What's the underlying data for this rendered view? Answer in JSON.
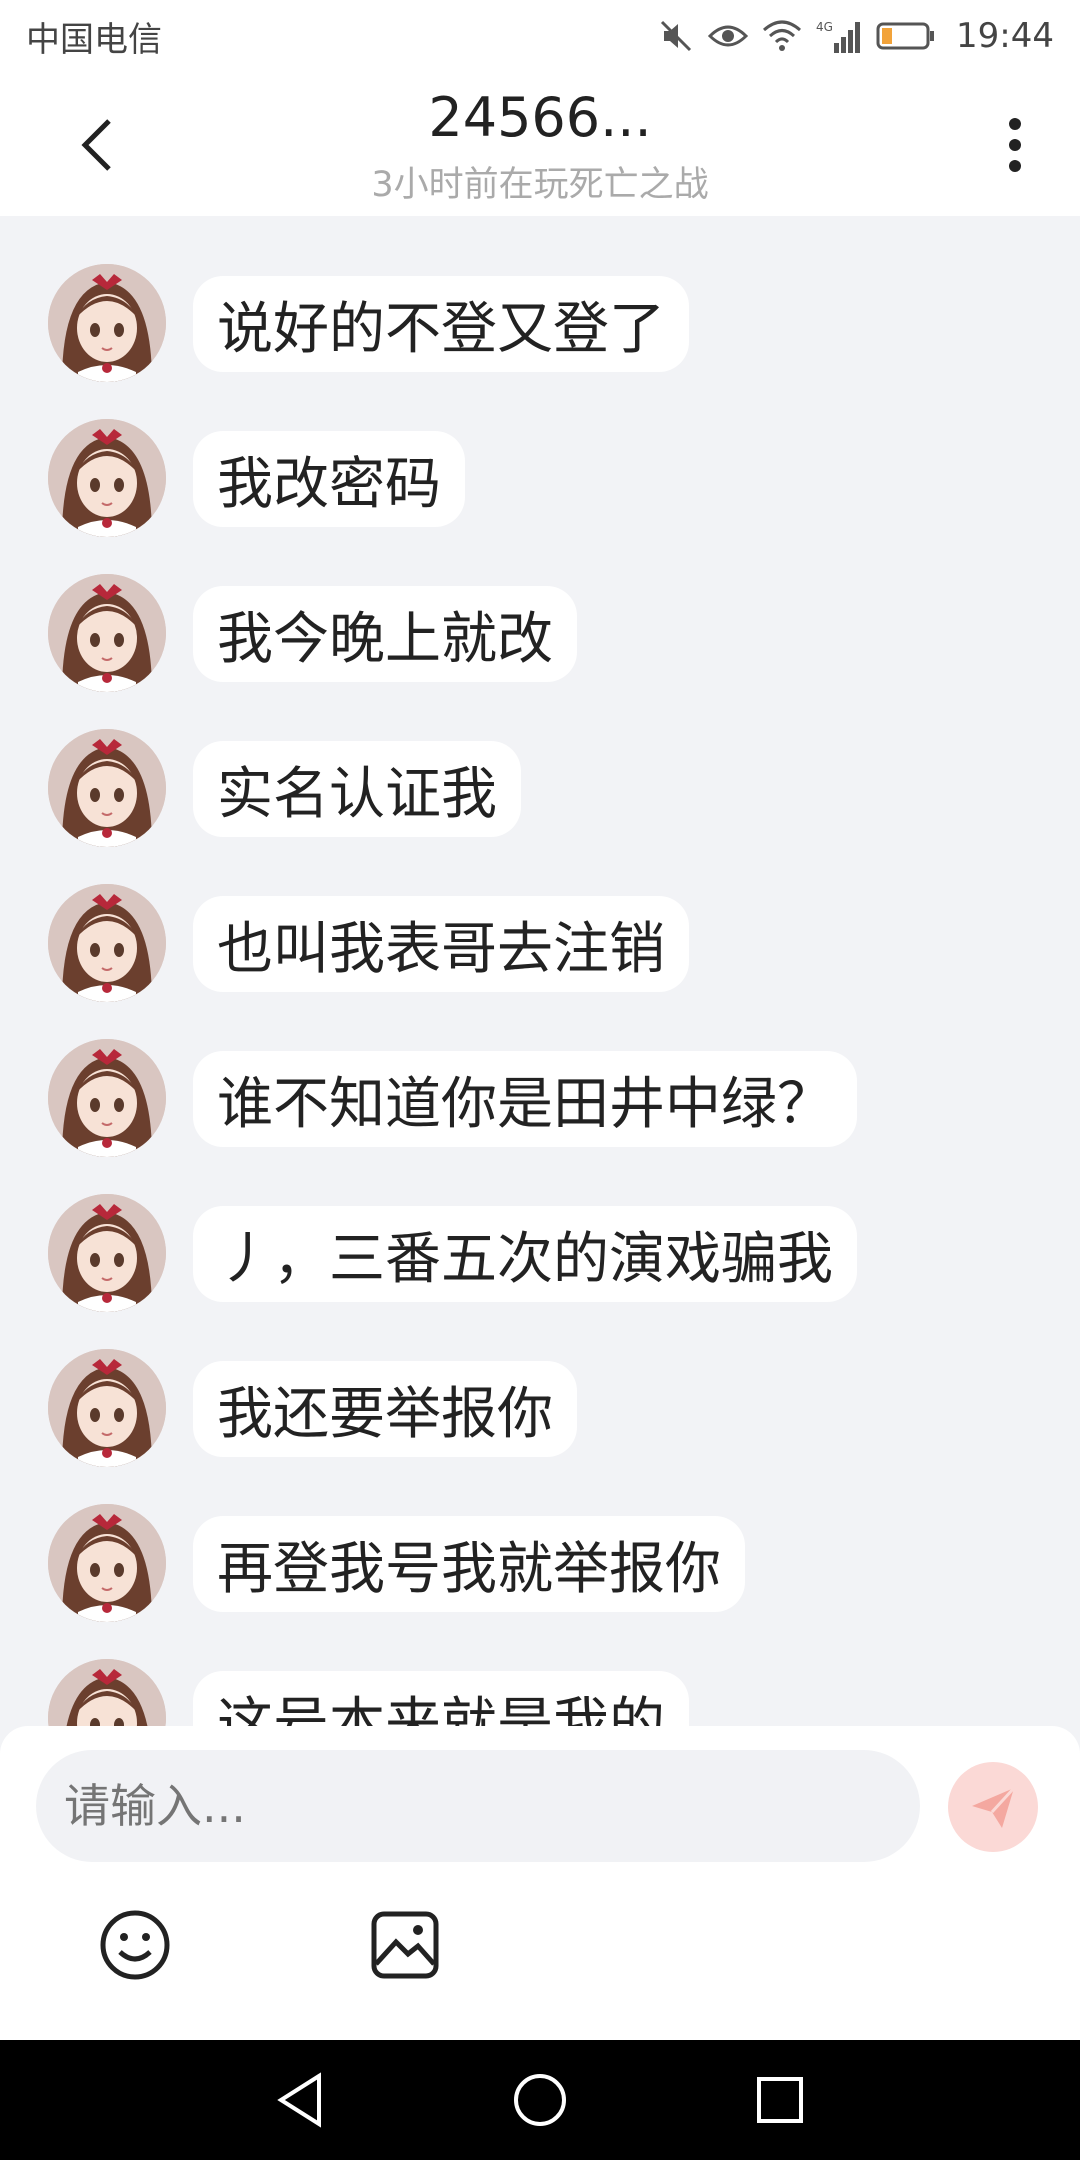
{
  "status_bar": {
    "carrier": "中国电信",
    "network": "4G",
    "time": "19:44",
    "icons": [
      "mute-icon",
      "eye-icon",
      "wifi-icon",
      "signal-icon",
      "battery-icon"
    ]
  },
  "header": {
    "title": "24566...",
    "subtitle": "3小时前在玩死亡之战"
  },
  "messages": [
    {
      "text": "说好的不登又登了"
    },
    {
      "text": "我改密码"
    },
    {
      "text": "我今晚上就改"
    },
    {
      "text": "实名认证我"
    },
    {
      "text": "也叫我表哥去注销"
    },
    {
      "text": "谁不知道你是田井中绿？"
    },
    {
      "text": "丿，三番五次的演戏骗我"
    },
    {
      "text": "我还要举报你"
    },
    {
      "text": "再登我号我就举报你"
    },
    {
      "text": "这号本来就是我的"
    }
  ],
  "input": {
    "placeholder": "请输入..."
  },
  "colors": {
    "background": "#f2f3f6",
    "bubble": "#ffffff",
    "send_button": "#fbd9d6",
    "send_icon": "#f4a8a0"
  }
}
